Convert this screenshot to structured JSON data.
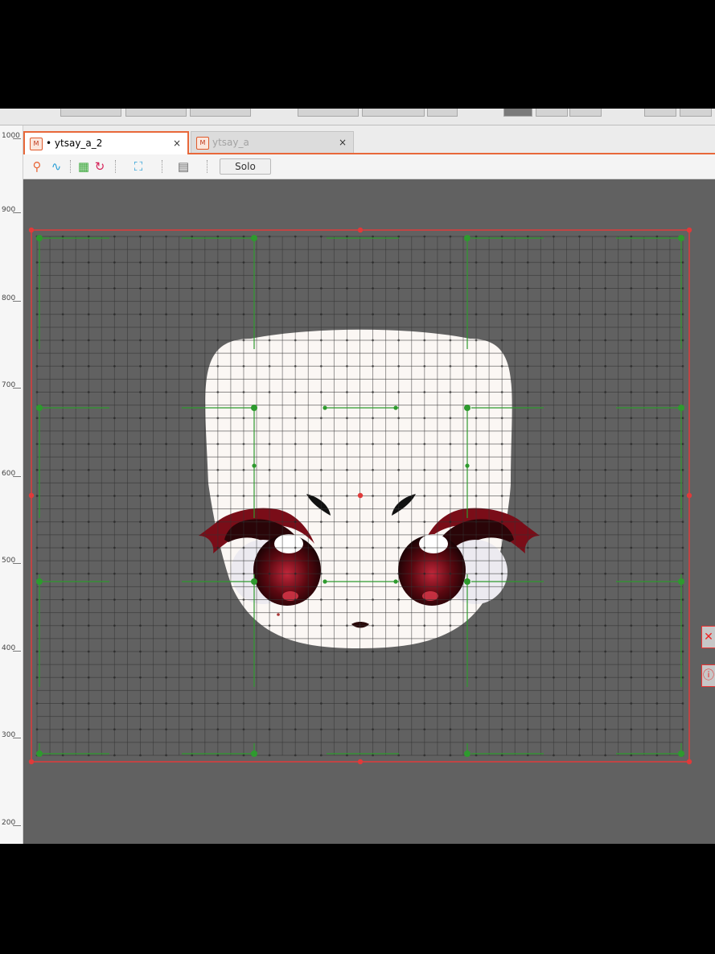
{
  "tabs": [
    {
      "label": "ytsay_a_2",
      "modified_marker": "•",
      "close": "×",
      "icon": "document-icon"
    },
    {
      "label": "ytsay_a",
      "close": "×",
      "icon": "document-icon"
    }
  ],
  "toolbar": {
    "tools": [
      "deform-path-icon",
      "curve-icon",
      "grid-color-icon",
      "rotate-icon",
      "fit-view-icon",
      "mesh-grid-icon"
    ],
    "solo_label": "Solo"
  },
  "ruler": {
    "labels": [
      "1000",
      "900",
      "800",
      "700",
      "600",
      "500",
      "400",
      "300",
      "200"
    ]
  },
  "colors": {
    "accent": "#e8683a",
    "warp_frame": "#e03a3a",
    "warp_guides": "#2e9a2e",
    "canvas_bg": "#616161"
  }
}
